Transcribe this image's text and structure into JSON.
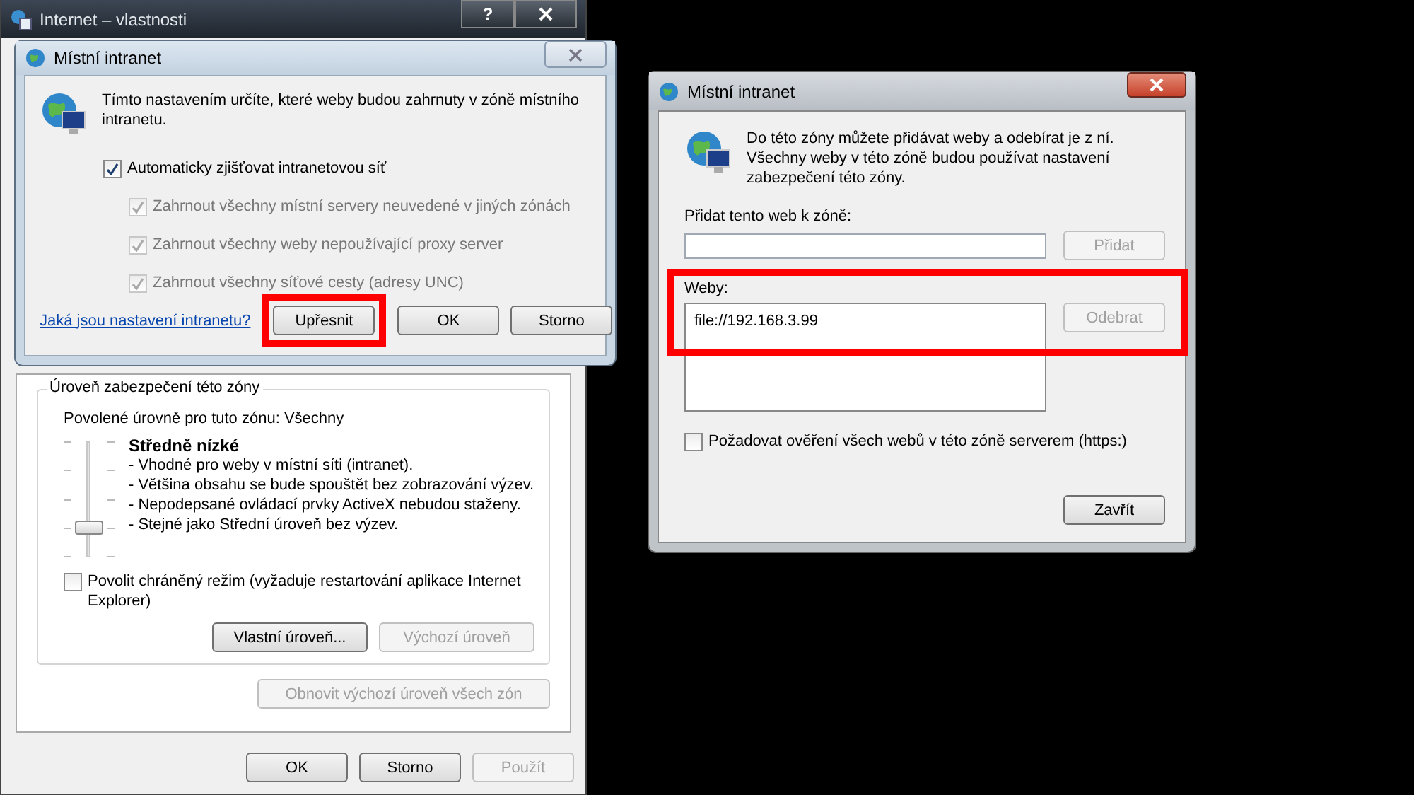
{
  "properties_window": {
    "title": "Internet – vlastnosti",
    "help_button": "?",
    "security_group": {
      "legend": "Úroveň zabezpečení této zóny",
      "allowed_levels": "Povolené úrovně pro tuto zónu: Všechny",
      "slider": {
        "level": 0.25
      },
      "level_name": "Středně nízké",
      "description": [
        "- Vhodné pro weby v místní síti (intranet).",
        "- Většina obsahu se bude spouštět bez zobrazování výzev.",
        "- Nepodepsané ovládací prvky ActiveX nebudou staženy.",
        "- Stejné jako Střední úroveň bez výzev."
      ],
      "protected_mode": {
        "label": "Povolit chráněný režim (vyžaduje restartování aplikace Internet Explorer)",
        "checked": false
      },
      "buttons": [
        {
          "label": "Vlastní úroveň...",
          "disabled": false
        },
        {
          "label": "Výchozí úroveň",
          "disabled": true
        }
      ]
    },
    "reset_button": {
      "label": "Obnovit výchozí úroveň všech zón",
      "disabled": true
    },
    "footer_buttons": [
      {
        "label": "OK",
        "disabled": false
      },
      {
        "label": "Storno",
        "disabled": false
      },
      {
        "label": "Použít",
        "disabled": true
      }
    ]
  },
  "intranet_dialog": {
    "title": "Místní intranet",
    "intro": "Tímto nastavením určíte, které weby budou zahrnuty v zóně místního intranetu.",
    "options": [
      {
        "label": "Automaticky zjišťovat intranetovou síť",
        "checked": true,
        "disabled": false,
        "children": [
          {
            "label": "Zahrnout všechny místní servery neuvedené v jiných zónách",
            "checked": true,
            "disabled": true
          },
          {
            "label": "Zahrnout všechny weby nepoužívající proxy server",
            "checked": true,
            "disabled": true
          },
          {
            "label": "Zahrnout všechny síťové cesty (adresy UNC)",
            "checked": true,
            "disabled": true
          }
        ]
      }
    ],
    "help_link": "Jaká jsou nastavení intranetu?",
    "buttons": [
      {
        "label": "Upřesnit",
        "highlighted": true
      },
      {
        "label": "OK",
        "highlighted": false
      },
      {
        "label": "Storno",
        "highlighted": false
      }
    ]
  },
  "sites_dialog": {
    "title": "Místní intranet",
    "intro": "Do této zóny můžete přidávat weby a odebírat je z ní. Všechny weby v této zóně budou používat nastavení zabezpečení této zóny.",
    "add_label": "Přidat tento web k zóně:",
    "add_button": {
      "label": "Přidat",
      "disabled": true
    },
    "sites_label": "Weby:",
    "sites_highlighted": true,
    "sites": [
      "file://192.168.3.99"
    ],
    "remove_button": {
      "label": "Odebrat",
      "disabled": true
    },
    "require_https": {
      "label": "Požadovat ověření všech webů v této zóně serverem (https:)",
      "checked": false
    },
    "close_button": {
      "label": "Zavřít",
      "disabled": false
    }
  }
}
